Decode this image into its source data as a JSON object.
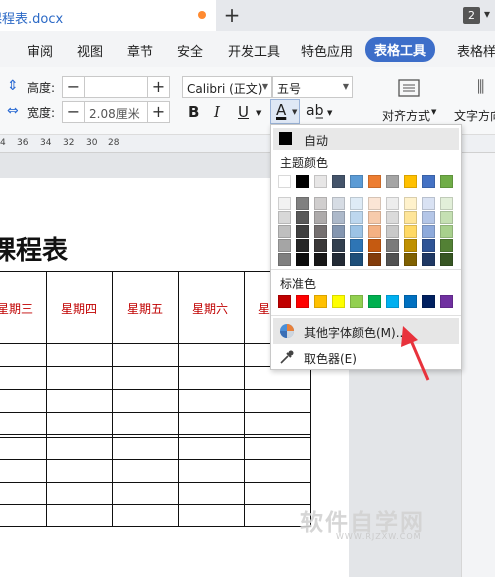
{
  "tab": {
    "filename": "课程表.docx",
    "window_count": "2"
  },
  "menu": {
    "items": [
      "审阅",
      "视图",
      "章节",
      "安全",
      "开发工具",
      "特色应用",
      "表格工具",
      "表格样"
    ],
    "active": "表格工具"
  },
  "toolbar": {
    "height_label": "高度:",
    "width_label": "宽度:",
    "width_value": "2.08厘米",
    "font_name": "Calibri (正文)",
    "font_size": "五号",
    "bold": "B",
    "italic": "I",
    "underline": "U",
    "font_color": "A",
    "align_label": "对齐方式",
    "text_dir_label": "文字方向"
  },
  "ruler": [
    "4",
    "36",
    "34",
    "32",
    "30",
    "28"
  ],
  "document": {
    "title": "课程表",
    "days": [
      "星期三",
      "星期四",
      "星期五",
      "星期六",
      "星"
    ]
  },
  "color_menu": {
    "auto_label": "自动",
    "theme_label": "主题颜色",
    "theme_top": [
      "#ffffff",
      "#000000",
      "#e7e6e6",
      "#44546a",
      "#5b9bd5",
      "#ed7d31",
      "#a5a5a5",
      "#ffc000",
      "#4472c4",
      "#70ad47"
    ],
    "theme_shades": [
      [
        "#f2f2f2",
        "#808080",
        "#d0cece",
        "#d6dce4",
        "#deebf6",
        "#fbe5d5",
        "#ededed",
        "#fff2cc",
        "#d9e2f3",
        "#e2efd9"
      ],
      [
        "#d8d8d8",
        "#595959",
        "#aeabab",
        "#adb9ca",
        "#bdd7ee",
        "#f7cbac",
        "#dbdbdb",
        "#fee599",
        "#b4c6e7",
        "#c5e0b3"
      ],
      [
        "#bfbfbf",
        "#3f3f3f",
        "#757070",
        "#8496b0",
        "#9cc3e5",
        "#f4b183",
        "#c9c9c9",
        "#ffd965",
        "#8eaadb",
        "#a8d08d"
      ],
      [
        "#a5a5a5",
        "#262626",
        "#3a3838",
        "#323f4f",
        "#2e75b5",
        "#c55a11",
        "#7b7b7b",
        "#bf9000",
        "#2f5496",
        "#538135"
      ],
      [
        "#7f7f7f",
        "#0c0c0c",
        "#171616",
        "#222a35",
        "#1e4e79",
        "#833c0b",
        "#525252",
        "#7f6000",
        "#1f3864",
        "#375623"
      ]
    ],
    "standard_label": "标准色",
    "standard": [
      "#c00000",
      "#ff0000",
      "#ffc000",
      "#ffff00",
      "#92d050",
      "#00b050",
      "#00b0f0",
      "#0070c0",
      "#002060",
      "#7030a0"
    ],
    "more_colors": "其他字体颜色(M)...",
    "eyedropper": "取色器(E)",
    "pointer_color": "#e8323c"
  },
  "watermark": {
    "main": "软件自学网",
    "sub": "WWW.RJZXW.COM"
  }
}
